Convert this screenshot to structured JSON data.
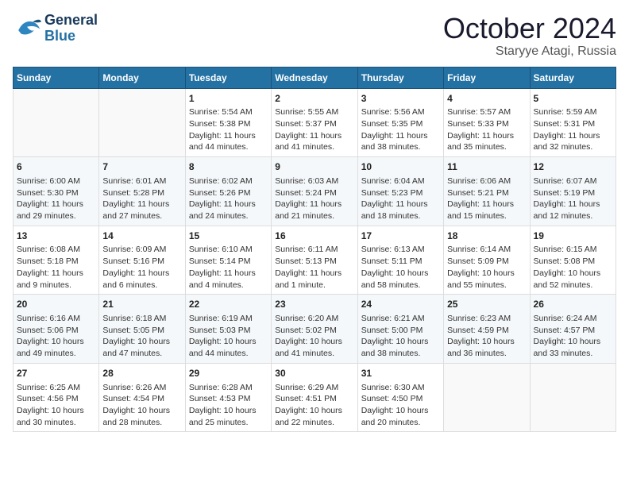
{
  "header": {
    "logo_line1": "General",
    "logo_line2": "Blue",
    "month": "October 2024",
    "location": "Staryye Atagi, Russia"
  },
  "days_of_week": [
    "Sunday",
    "Monday",
    "Tuesday",
    "Wednesday",
    "Thursday",
    "Friday",
    "Saturday"
  ],
  "weeks": [
    [
      {
        "day": "",
        "content": ""
      },
      {
        "day": "",
        "content": ""
      },
      {
        "day": "1",
        "content": "Sunrise: 5:54 AM\nSunset: 5:38 PM\nDaylight: 11 hours and 44 minutes."
      },
      {
        "day": "2",
        "content": "Sunrise: 5:55 AM\nSunset: 5:37 PM\nDaylight: 11 hours and 41 minutes."
      },
      {
        "day": "3",
        "content": "Sunrise: 5:56 AM\nSunset: 5:35 PM\nDaylight: 11 hours and 38 minutes."
      },
      {
        "day": "4",
        "content": "Sunrise: 5:57 AM\nSunset: 5:33 PM\nDaylight: 11 hours and 35 minutes."
      },
      {
        "day": "5",
        "content": "Sunrise: 5:59 AM\nSunset: 5:31 PM\nDaylight: 11 hours and 32 minutes."
      }
    ],
    [
      {
        "day": "6",
        "content": "Sunrise: 6:00 AM\nSunset: 5:30 PM\nDaylight: 11 hours and 29 minutes."
      },
      {
        "day": "7",
        "content": "Sunrise: 6:01 AM\nSunset: 5:28 PM\nDaylight: 11 hours and 27 minutes."
      },
      {
        "day": "8",
        "content": "Sunrise: 6:02 AM\nSunset: 5:26 PM\nDaylight: 11 hours and 24 minutes."
      },
      {
        "day": "9",
        "content": "Sunrise: 6:03 AM\nSunset: 5:24 PM\nDaylight: 11 hours and 21 minutes."
      },
      {
        "day": "10",
        "content": "Sunrise: 6:04 AM\nSunset: 5:23 PM\nDaylight: 11 hours and 18 minutes."
      },
      {
        "day": "11",
        "content": "Sunrise: 6:06 AM\nSunset: 5:21 PM\nDaylight: 11 hours and 15 minutes."
      },
      {
        "day": "12",
        "content": "Sunrise: 6:07 AM\nSunset: 5:19 PM\nDaylight: 11 hours and 12 minutes."
      }
    ],
    [
      {
        "day": "13",
        "content": "Sunrise: 6:08 AM\nSunset: 5:18 PM\nDaylight: 11 hours and 9 minutes."
      },
      {
        "day": "14",
        "content": "Sunrise: 6:09 AM\nSunset: 5:16 PM\nDaylight: 11 hours and 6 minutes."
      },
      {
        "day": "15",
        "content": "Sunrise: 6:10 AM\nSunset: 5:14 PM\nDaylight: 11 hours and 4 minutes."
      },
      {
        "day": "16",
        "content": "Sunrise: 6:11 AM\nSunset: 5:13 PM\nDaylight: 11 hours and 1 minute."
      },
      {
        "day": "17",
        "content": "Sunrise: 6:13 AM\nSunset: 5:11 PM\nDaylight: 10 hours and 58 minutes."
      },
      {
        "day": "18",
        "content": "Sunrise: 6:14 AM\nSunset: 5:09 PM\nDaylight: 10 hours and 55 minutes."
      },
      {
        "day": "19",
        "content": "Sunrise: 6:15 AM\nSunset: 5:08 PM\nDaylight: 10 hours and 52 minutes."
      }
    ],
    [
      {
        "day": "20",
        "content": "Sunrise: 6:16 AM\nSunset: 5:06 PM\nDaylight: 10 hours and 49 minutes."
      },
      {
        "day": "21",
        "content": "Sunrise: 6:18 AM\nSunset: 5:05 PM\nDaylight: 10 hours and 47 minutes."
      },
      {
        "day": "22",
        "content": "Sunrise: 6:19 AM\nSunset: 5:03 PM\nDaylight: 10 hours and 44 minutes."
      },
      {
        "day": "23",
        "content": "Sunrise: 6:20 AM\nSunset: 5:02 PM\nDaylight: 10 hours and 41 minutes."
      },
      {
        "day": "24",
        "content": "Sunrise: 6:21 AM\nSunset: 5:00 PM\nDaylight: 10 hours and 38 minutes."
      },
      {
        "day": "25",
        "content": "Sunrise: 6:23 AM\nSunset: 4:59 PM\nDaylight: 10 hours and 36 minutes."
      },
      {
        "day": "26",
        "content": "Sunrise: 6:24 AM\nSunset: 4:57 PM\nDaylight: 10 hours and 33 minutes."
      }
    ],
    [
      {
        "day": "27",
        "content": "Sunrise: 6:25 AM\nSunset: 4:56 PM\nDaylight: 10 hours and 30 minutes."
      },
      {
        "day": "28",
        "content": "Sunrise: 6:26 AM\nSunset: 4:54 PM\nDaylight: 10 hours and 28 minutes."
      },
      {
        "day": "29",
        "content": "Sunrise: 6:28 AM\nSunset: 4:53 PM\nDaylight: 10 hours and 25 minutes."
      },
      {
        "day": "30",
        "content": "Sunrise: 6:29 AM\nSunset: 4:51 PM\nDaylight: 10 hours and 22 minutes."
      },
      {
        "day": "31",
        "content": "Sunrise: 6:30 AM\nSunset: 4:50 PM\nDaylight: 10 hours and 20 minutes."
      },
      {
        "day": "",
        "content": ""
      },
      {
        "day": "",
        "content": ""
      }
    ]
  ]
}
